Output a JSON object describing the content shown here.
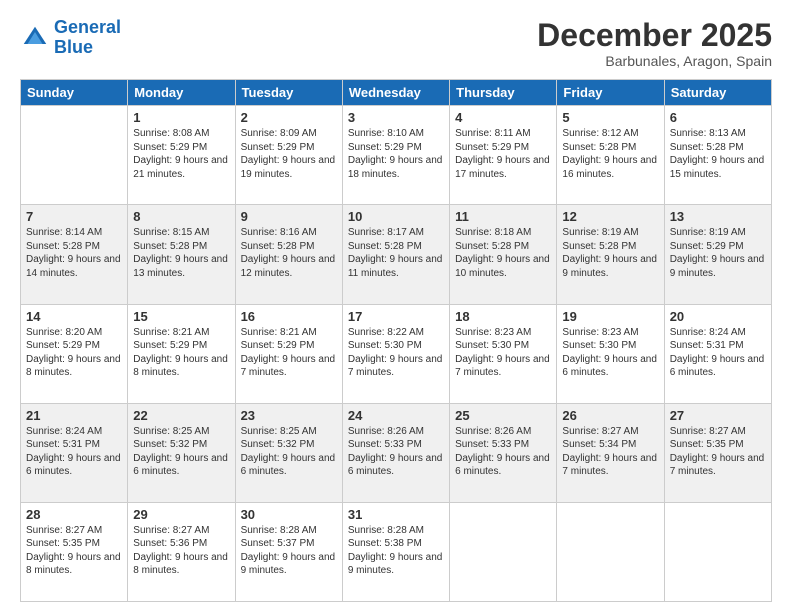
{
  "logo": {
    "line1": "General",
    "line2": "Blue"
  },
  "title": "December 2025",
  "location": "Barbunales, Aragon, Spain",
  "weekdays": [
    "Sunday",
    "Monday",
    "Tuesday",
    "Wednesday",
    "Thursday",
    "Friday",
    "Saturday"
  ],
  "weeks": [
    [
      {
        "day": "",
        "sunrise": "",
        "sunset": "",
        "daylight": ""
      },
      {
        "day": "1",
        "sunrise": "Sunrise: 8:08 AM",
        "sunset": "Sunset: 5:29 PM",
        "daylight": "Daylight: 9 hours and 21 minutes."
      },
      {
        "day": "2",
        "sunrise": "Sunrise: 8:09 AM",
        "sunset": "Sunset: 5:29 PM",
        "daylight": "Daylight: 9 hours and 19 minutes."
      },
      {
        "day": "3",
        "sunrise": "Sunrise: 8:10 AM",
        "sunset": "Sunset: 5:29 PM",
        "daylight": "Daylight: 9 hours and 18 minutes."
      },
      {
        "day": "4",
        "sunrise": "Sunrise: 8:11 AM",
        "sunset": "Sunset: 5:29 PM",
        "daylight": "Daylight: 9 hours and 17 minutes."
      },
      {
        "day": "5",
        "sunrise": "Sunrise: 8:12 AM",
        "sunset": "Sunset: 5:28 PM",
        "daylight": "Daylight: 9 hours and 16 minutes."
      },
      {
        "day": "6",
        "sunrise": "Sunrise: 8:13 AM",
        "sunset": "Sunset: 5:28 PM",
        "daylight": "Daylight: 9 hours and 15 minutes."
      }
    ],
    [
      {
        "day": "7",
        "sunrise": "Sunrise: 8:14 AM",
        "sunset": "Sunset: 5:28 PM",
        "daylight": "Daylight: 9 hours and 14 minutes."
      },
      {
        "day": "8",
        "sunrise": "Sunrise: 8:15 AM",
        "sunset": "Sunset: 5:28 PM",
        "daylight": "Daylight: 9 hours and 13 minutes."
      },
      {
        "day": "9",
        "sunrise": "Sunrise: 8:16 AM",
        "sunset": "Sunset: 5:28 PM",
        "daylight": "Daylight: 9 hours and 12 minutes."
      },
      {
        "day": "10",
        "sunrise": "Sunrise: 8:17 AM",
        "sunset": "Sunset: 5:28 PM",
        "daylight": "Daylight: 9 hours and 11 minutes."
      },
      {
        "day": "11",
        "sunrise": "Sunrise: 8:18 AM",
        "sunset": "Sunset: 5:28 PM",
        "daylight": "Daylight: 9 hours and 10 minutes."
      },
      {
        "day": "12",
        "sunrise": "Sunrise: 8:19 AM",
        "sunset": "Sunset: 5:28 PM",
        "daylight": "Daylight: 9 hours and 9 minutes."
      },
      {
        "day": "13",
        "sunrise": "Sunrise: 8:19 AM",
        "sunset": "Sunset: 5:29 PM",
        "daylight": "Daylight: 9 hours and 9 minutes."
      }
    ],
    [
      {
        "day": "14",
        "sunrise": "Sunrise: 8:20 AM",
        "sunset": "Sunset: 5:29 PM",
        "daylight": "Daylight: 9 hours and 8 minutes."
      },
      {
        "day": "15",
        "sunrise": "Sunrise: 8:21 AM",
        "sunset": "Sunset: 5:29 PM",
        "daylight": "Daylight: 9 hours and 8 minutes."
      },
      {
        "day": "16",
        "sunrise": "Sunrise: 8:21 AM",
        "sunset": "Sunset: 5:29 PM",
        "daylight": "Daylight: 9 hours and 7 minutes."
      },
      {
        "day": "17",
        "sunrise": "Sunrise: 8:22 AM",
        "sunset": "Sunset: 5:30 PM",
        "daylight": "Daylight: 9 hours and 7 minutes."
      },
      {
        "day": "18",
        "sunrise": "Sunrise: 8:23 AM",
        "sunset": "Sunset: 5:30 PM",
        "daylight": "Daylight: 9 hours and 7 minutes."
      },
      {
        "day": "19",
        "sunrise": "Sunrise: 8:23 AM",
        "sunset": "Sunset: 5:30 PM",
        "daylight": "Daylight: 9 hours and 6 minutes."
      },
      {
        "day": "20",
        "sunrise": "Sunrise: 8:24 AM",
        "sunset": "Sunset: 5:31 PM",
        "daylight": "Daylight: 9 hours and 6 minutes."
      }
    ],
    [
      {
        "day": "21",
        "sunrise": "Sunrise: 8:24 AM",
        "sunset": "Sunset: 5:31 PM",
        "daylight": "Daylight: 9 hours and 6 minutes."
      },
      {
        "day": "22",
        "sunrise": "Sunrise: 8:25 AM",
        "sunset": "Sunset: 5:32 PM",
        "daylight": "Daylight: 9 hours and 6 minutes."
      },
      {
        "day": "23",
        "sunrise": "Sunrise: 8:25 AM",
        "sunset": "Sunset: 5:32 PM",
        "daylight": "Daylight: 9 hours and 6 minutes."
      },
      {
        "day": "24",
        "sunrise": "Sunrise: 8:26 AM",
        "sunset": "Sunset: 5:33 PM",
        "daylight": "Daylight: 9 hours and 6 minutes."
      },
      {
        "day": "25",
        "sunrise": "Sunrise: 8:26 AM",
        "sunset": "Sunset: 5:33 PM",
        "daylight": "Daylight: 9 hours and 6 minutes."
      },
      {
        "day": "26",
        "sunrise": "Sunrise: 8:27 AM",
        "sunset": "Sunset: 5:34 PM",
        "daylight": "Daylight: 9 hours and 7 minutes."
      },
      {
        "day": "27",
        "sunrise": "Sunrise: 8:27 AM",
        "sunset": "Sunset: 5:35 PM",
        "daylight": "Daylight: 9 hours and 7 minutes."
      }
    ],
    [
      {
        "day": "28",
        "sunrise": "Sunrise: 8:27 AM",
        "sunset": "Sunset: 5:35 PM",
        "daylight": "Daylight: 9 hours and 8 minutes."
      },
      {
        "day": "29",
        "sunrise": "Sunrise: 8:27 AM",
        "sunset": "Sunset: 5:36 PM",
        "daylight": "Daylight: 9 hours and 8 minutes."
      },
      {
        "day": "30",
        "sunrise": "Sunrise: 8:28 AM",
        "sunset": "Sunset: 5:37 PM",
        "daylight": "Daylight: 9 hours and 9 minutes."
      },
      {
        "day": "31",
        "sunrise": "Sunrise: 8:28 AM",
        "sunset": "Sunset: 5:38 PM",
        "daylight": "Daylight: 9 hours and 9 minutes."
      },
      {
        "day": "",
        "sunrise": "",
        "sunset": "",
        "daylight": ""
      },
      {
        "day": "",
        "sunrise": "",
        "sunset": "",
        "daylight": ""
      },
      {
        "day": "",
        "sunrise": "",
        "sunset": "",
        "daylight": ""
      }
    ]
  ]
}
